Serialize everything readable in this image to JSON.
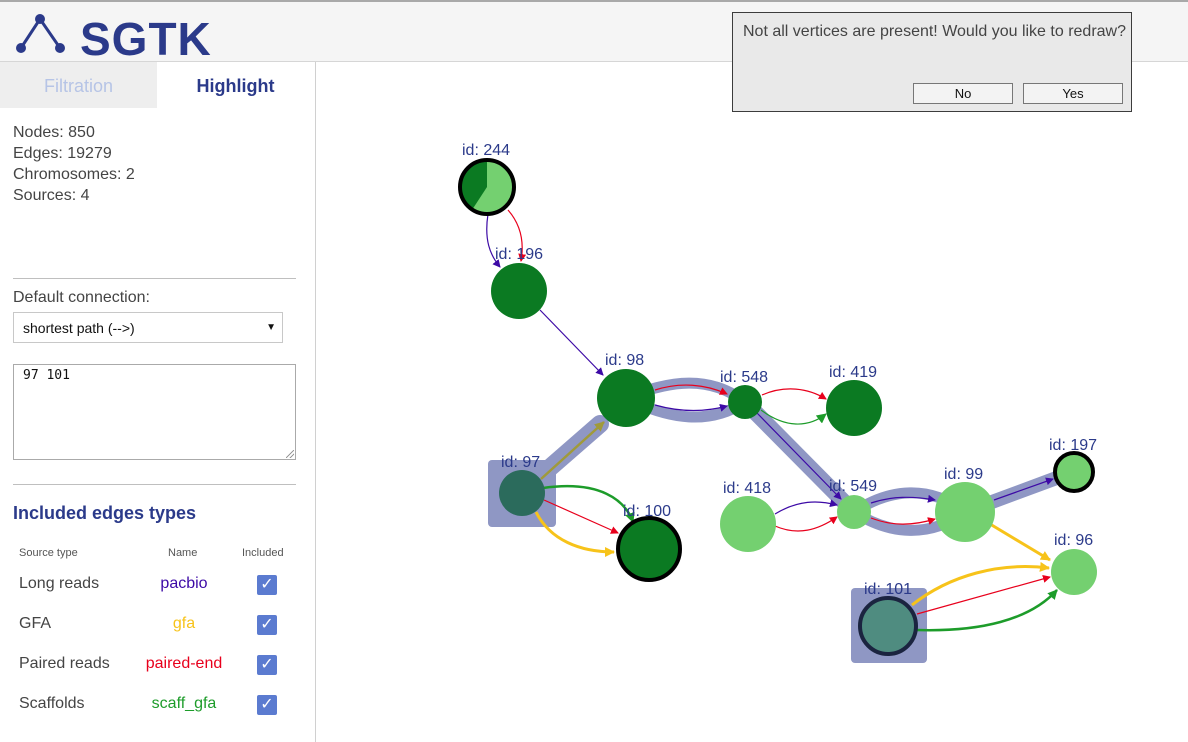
{
  "app": {
    "title": "SGTK"
  },
  "tabs": [
    {
      "label": "Filtration"
    },
    {
      "label": "Highlight"
    }
  ],
  "stats": {
    "nodes": "Nodes: 850",
    "edges": "Edges: 19279",
    "chromosomes": "Chromosomes: 2",
    "sources": "Sources: 4"
  },
  "connection": {
    "label": "Default connection:",
    "value": "shortest path (-->)"
  },
  "vertices_input": {
    "value": "97 101"
  },
  "edge_types": {
    "title": "Included edges types",
    "headers": {
      "source": "Source type",
      "name": "Name",
      "included": "Included"
    },
    "rows": [
      {
        "source": "Long reads",
        "name": "pacbio",
        "color": "#3d0aa6"
      },
      {
        "source": "GFA",
        "name": "gfa",
        "color": "#f7c31a"
      },
      {
        "source": "Paired reads",
        "name": "paired-end",
        "color": "#e8001c"
      },
      {
        "source": "Scaffolds",
        "name": "scaff_gfa",
        "color": "#1d9c2a"
      }
    ]
  },
  "dialog": {
    "message": "Not all vertices are present! Would you like to redraw?",
    "no_label": "No",
    "yes_label": "Yes"
  },
  "graph": {
    "node_labels": {
      "n244": "id: 244",
      "n196": "id: 196",
      "n98": "id: 98",
      "n548": "id: 548",
      "n419": "id: 419",
      "n97": "id: 97",
      "n100": "id: 100",
      "n418": "id: 418",
      "n549": "id: 549",
      "n99": "id: 99",
      "n197": "id: 197",
      "n96": "id: 96",
      "n101": "id: 101"
    },
    "colors": {
      "dark_green": "#0b7a22",
      "light_green": "#74d070",
      "selected_dark": "#2b6b5c",
      "selected_light": "#4f8c80",
      "highlight": "#8f97c4"
    }
  }
}
